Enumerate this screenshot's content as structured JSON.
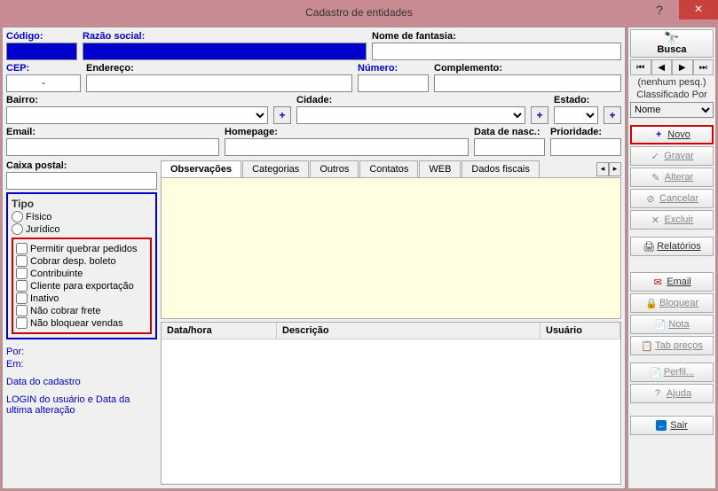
{
  "window": {
    "title": "Cadastro de entidades"
  },
  "labels": {
    "codigo": "Código:",
    "razao": "Razão social:",
    "fantasia": "Nome de fantasia:",
    "cep": "CEP:",
    "endereco": "Endereço:",
    "numero": "Número:",
    "complemento": "Complemento:",
    "bairro": "Bairro:",
    "cidade": "Cidade:",
    "estado": "Estado:",
    "email": "Email:",
    "homepage": "Homepage:",
    "datanasc": "Data de nasc.:",
    "prioridade": "Prioridade:",
    "caixa": "Caixa postal:",
    "cep_value": "-"
  },
  "tipo": {
    "title": "Tipo",
    "fisico": "Físico",
    "juridico": "Jurídico"
  },
  "checks": {
    "permitir": "Permitir quebrar pedidos",
    "cobrar": "Cobrar desp. boleto",
    "contribuinte": "Contribuinte",
    "exportacao": "Cliente para exportação",
    "inativo": "Inativo",
    "naocobrar": "Não cobrar frete",
    "naobloquear": "Não bloquear vendas"
  },
  "meta": {
    "por": "Por:",
    "em": "Em:",
    "data_cadastro": "Data do cadastro",
    "login": "LOGIN do usuário e Data da ultima alteração"
  },
  "tabs": {
    "obs": "Observações",
    "cat": "Categorias",
    "outros": "Outros",
    "contatos": "Contatos",
    "web": "WEB",
    "fiscais": "Dados fiscais"
  },
  "grid": {
    "c1": "Data/hora",
    "c2": "Descrição",
    "c3": "Usuário"
  },
  "sidebar": {
    "busca": "Busca",
    "pesq": "(nenhum pesq.)",
    "class": "Classificado Por",
    "class_sel": "Nome",
    "novo": "Novo",
    "gravar": "Gravar",
    "alterar": "Alterar",
    "cancelar": "Cancelar",
    "excluir": "Excluir",
    "rel": "Relatórios",
    "email": "Email",
    "bloquear": "Bloquear",
    "nota": "Nota",
    "tabprecos": "Tab preços",
    "perfil": "Perfil...",
    "ajuda": "Ajuda",
    "sair": "Sair"
  }
}
